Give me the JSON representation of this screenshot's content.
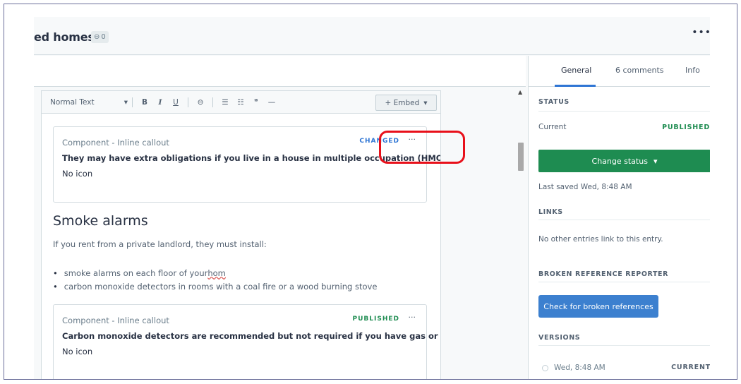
{
  "header": {
    "title": "ed homes",
    "ref_count": "0",
    "more_label": "•••"
  },
  "toolbar": {
    "format_select": "Normal Text",
    "bold": "B",
    "italic": "I",
    "underline": "U",
    "link": "⊖",
    "bullet_list": "☰",
    "numbered_list": "☷",
    "quote": "❞",
    "hr": "—",
    "embed_label": "+ Embed"
  },
  "editor": {
    "callout1": {
      "type": "Component - Inline callout",
      "status": "CHANGED",
      "more": "···",
      "title": "They may have extra obligations if you live in a house in multiple occupation (HMO)",
      "icon": "No icon"
    },
    "heading": "Smoke alarms",
    "paragraph": "If you rent from a private landlord, they must install:",
    "bullets": [
      {
        "pre": "smoke alarms on each floor of your ",
        "misspelled": "hom"
      },
      {
        "pre": "carbon monoxide detectors in rooms with a coal fire or a wood burning stove",
        "misspelled": ""
      }
    ],
    "callout2": {
      "type": "Component - Inline callout",
      "status": "PUBLISHED",
      "more": "···",
      "title": "Carbon monoxide detectors are recommended but not required if you have gas or oi...",
      "icon": "No icon"
    }
  },
  "sidebar": {
    "tabs": [
      "General",
      "6 comments",
      "Info"
    ],
    "status": {
      "heading": "STATUS",
      "current_label": "Current",
      "current_value": "PUBLISHED",
      "change_button": "Change status",
      "last_saved": "Last saved Wed, 8:48 AM"
    },
    "links": {
      "heading": "LINKS",
      "text": "No other entries link to this entry."
    },
    "broken": {
      "heading": "BROKEN REFERENCE REPORTER",
      "button": "Check for broken references"
    },
    "versions": {
      "heading": "VERSIONS",
      "items": [
        {
          "label": "Wed, 8:48 AM",
          "tag": "CURRENT"
        }
      ]
    }
  },
  "colors": {
    "published": "#1e8c51",
    "changed": "#2e75d4",
    "primary_button": "#3c80cf",
    "highlight_ring": "#e8101a"
  }
}
